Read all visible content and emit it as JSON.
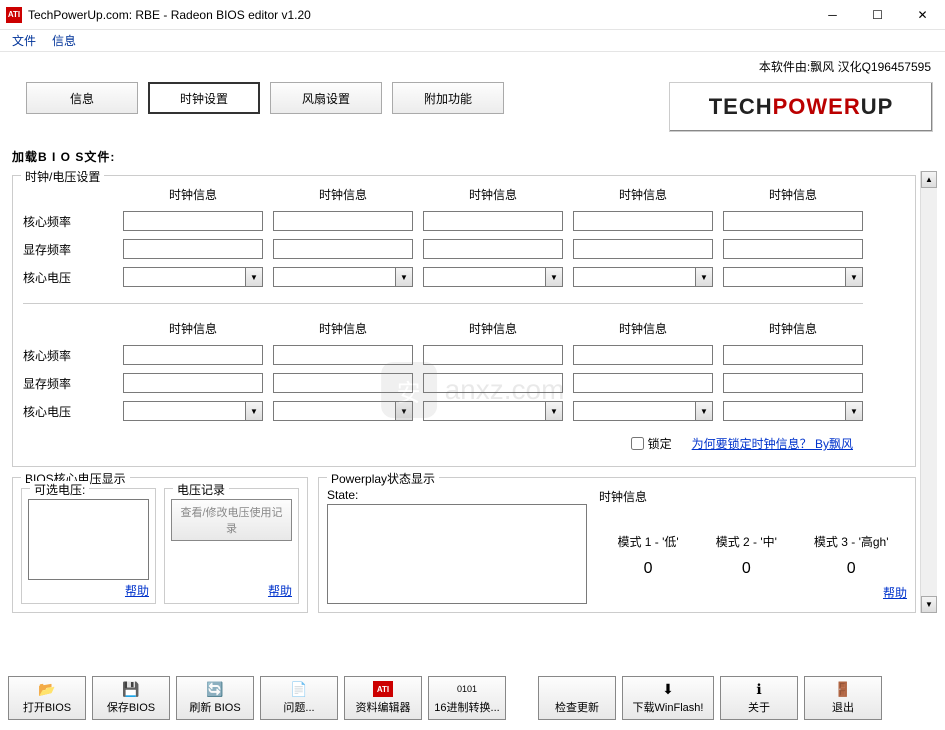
{
  "window": {
    "title": "TechPowerUp.com: RBE - Radeon BIOS editor v1.20",
    "icon_text": "ATI"
  },
  "menu": {
    "file": "文件",
    "info": "信息"
  },
  "credit": "本软件由:飘风 汉化Q196457595",
  "tabs": {
    "info": "信息",
    "clock": "时钟设置",
    "fan": "风扇设置",
    "extra": "附加功能"
  },
  "logo": {
    "t1": "TECH",
    "t2": "POWER",
    "t3": "UP"
  },
  "file_label": "加载B I O S文件:",
  "clock_group": {
    "title": "时钟/电压设置",
    "col_head": "时钟信息",
    "row_core": "核心频率",
    "row_mem": "显存频率",
    "row_volt": "核心电压",
    "lock": "锁定",
    "lock_link": "为何要锁定时钟信息？ By飘风"
  },
  "volt_group": {
    "title": "BIOS核心电压显示",
    "sub1": "可选电压:",
    "sub2": "电压记录",
    "btn": "查看/修改电压使用记录",
    "help": "帮助"
  },
  "pp_group": {
    "title": "Powerplay状态显示",
    "state": "State:",
    "head": "时钟信息",
    "m1": "模式 1 - '低'",
    "m2": "模式 2 - '中'",
    "m3": "模式 3 - '高gh'",
    "v1": "0",
    "v2": "0",
    "v3": "0",
    "help": "帮助"
  },
  "toolbar": {
    "open": "打开BIOS",
    "save": "保存BIOS",
    "flash": "刷新 BIOS",
    "issue": "问题...",
    "dataedit": "资料编辑器",
    "hexconv": "16进制转换...",
    "check": "检查更新",
    "winflash": "下载WinFlash!",
    "about": "关于",
    "exit": "退出"
  },
  "watermark": "anxz.com"
}
